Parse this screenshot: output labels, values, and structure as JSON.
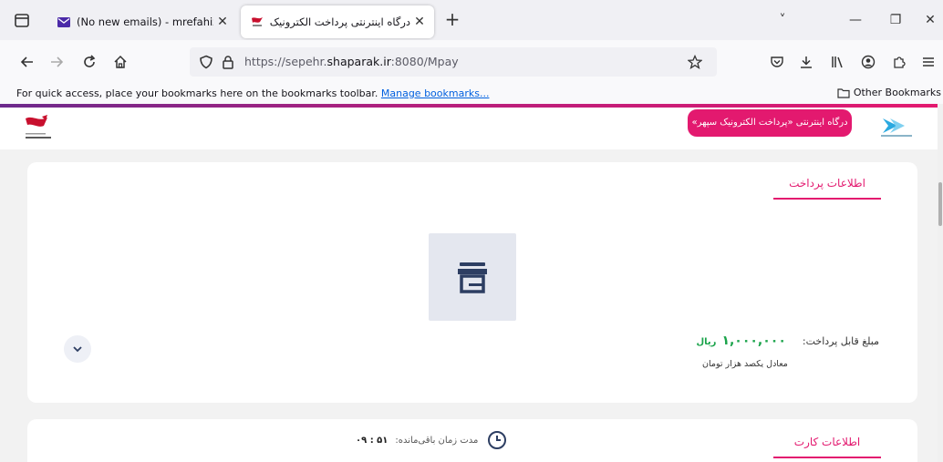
{
  "browser": {
    "tabs": [
      {
        "title": "(No new emails) - mrefahizade",
        "icon": "mail-icon"
      },
      {
        "title": "درگاه اینترنتی پرداخت الکترونیک",
        "icon": "sepehr-favicon"
      }
    ],
    "new_tab": "+",
    "window_controls": {
      "list": "˅",
      "minimize": "—",
      "restore": "❐",
      "close": "✕"
    },
    "url_prefix": "https://sepehr.",
    "url_domain": "shaparak.ir",
    "url_suffix": ":8080/Mpay",
    "bookmarks_text": "For quick access, place your bookmarks here on the bookmarks toolbar.",
    "bookmarks_link": "Manage bookmarks...",
    "other_bookmarks": "Other Bookmarks"
  },
  "header": {
    "gateway_title": "درگاه اینترنتی «پرداخت الکترونیک سپهر»",
    "accent_color": "#e3196f"
  },
  "payment": {
    "title": "اطلاعات پرداخت",
    "amount_label": "مبلغ قابل پرداخت:",
    "amount_value": "۱,۰۰۰,۰۰۰",
    "amount_unit": "ریال",
    "amount_words": "معادل یکصد هزار تومان",
    "merchant_icon": "store-icon"
  },
  "card": {
    "title": "اطلاعات کارت",
    "timer_label": "مدت زمان باقی‌مانده:",
    "timer_value": "۰۹ : ۵۱"
  }
}
